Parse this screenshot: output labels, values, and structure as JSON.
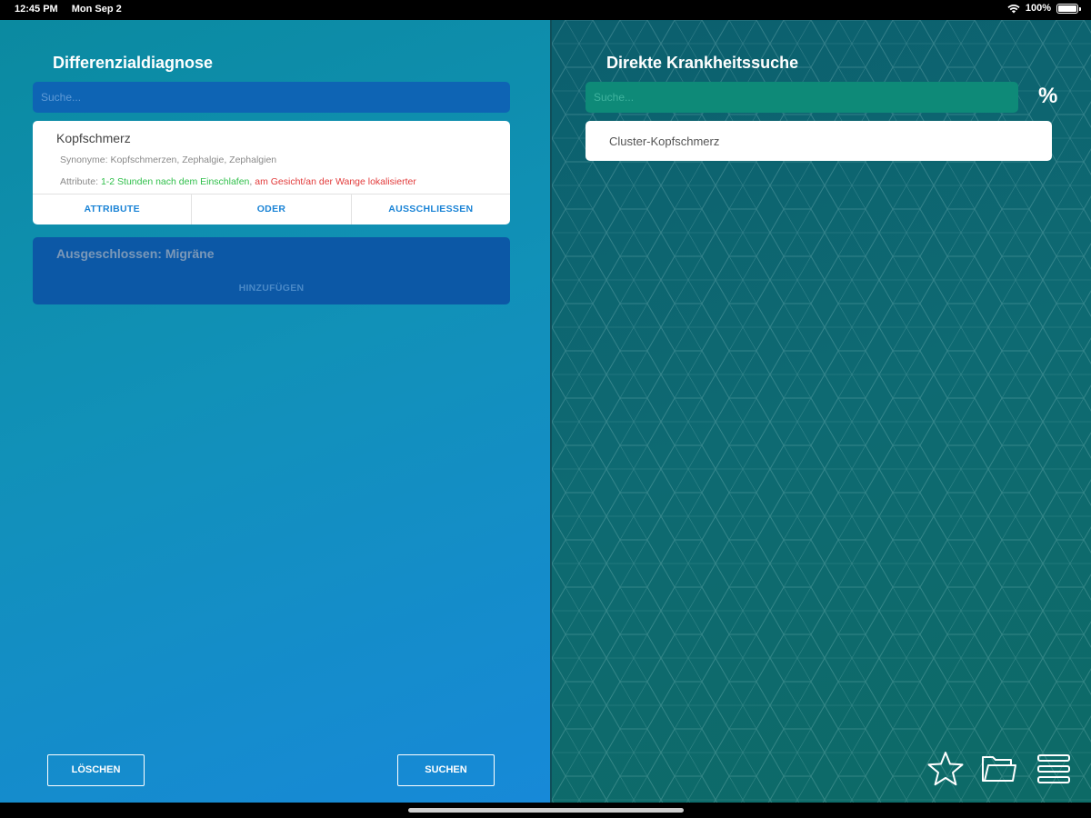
{
  "status_bar": {
    "time": "12:45 PM",
    "date": "Mon Sep 2",
    "battery": "100%",
    "icons": [
      "wifi-icon",
      "battery-icon"
    ]
  },
  "left_panel": {
    "title": "Differenzialdiagnose",
    "search": {
      "placeholder": "Suche...",
      "value": ""
    },
    "symptom_card": {
      "name": "Kopfschmerz",
      "synonyms": "Synonyme: Kopfschmerzen, Zephalgie, Zephalgien",
      "attributes_prefix": "Attribute: ",
      "attribute_included": "1-2 Stunden nach dem Einschlafen",
      "attribute_separator": ", ",
      "attribute_excluded": "am Gesicht/an der Wange lokalisierter",
      "actions": [
        "ATTRIBUTE",
        "ODER",
        "AUSSCHLIESSEN"
      ]
    },
    "excluded_card": {
      "label": "Ausgeschlossen: Migräne",
      "add_label": "HINZUFÜGEN"
    },
    "buttons": {
      "delete": "LÖSCHEN",
      "search": "SUCHEN"
    }
  },
  "right_panel": {
    "title": "Direkte Krankheitssuche",
    "search": {
      "placeholder": "Suche...",
      "value": ""
    },
    "percent_label": "%",
    "results": [
      "Cluster-Kopfschmerz"
    ],
    "toolbar_icons": [
      "star-icon",
      "folder-icon",
      "menu-icon"
    ]
  },
  "colors": {
    "attribute_included": "#2fbf4a",
    "attribute_excluded": "#e23b3b",
    "action_text": "#1b84d6"
  }
}
